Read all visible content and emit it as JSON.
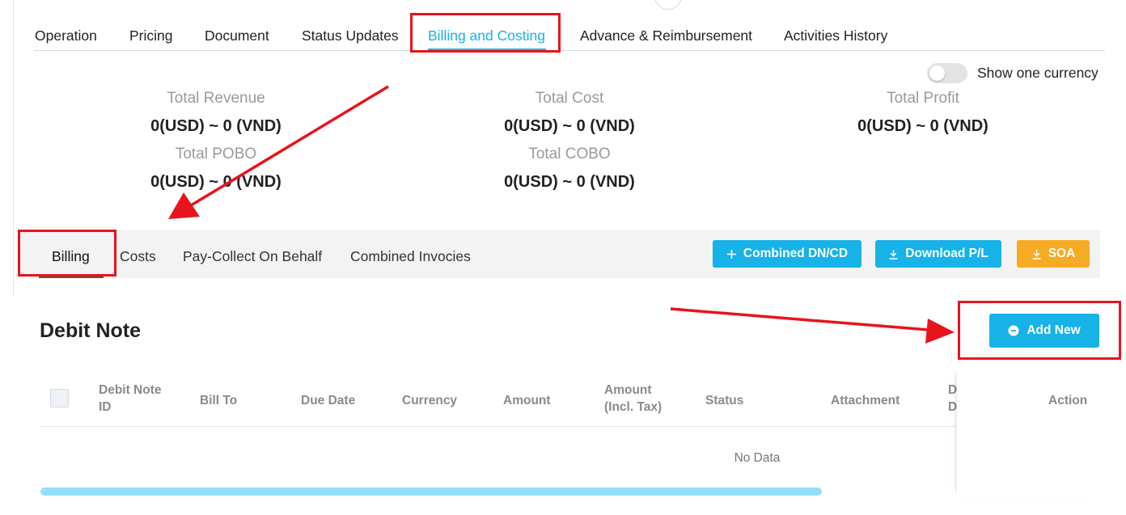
{
  "main_tabs": [
    {
      "label": "Operation"
    },
    {
      "label": "Pricing"
    },
    {
      "label": "Document"
    },
    {
      "label": "Status Updates"
    },
    {
      "label": "Billing and Costing",
      "active": true
    },
    {
      "label": "Advance & Reimbursement"
    },
    {
      "label": "Activities History"
    }
  ],
  "currency_toggle": {
    "label": "Show one currency",
    "on": false
  },
  "summary": {
    "total_revenue": {
      "label": "Total Revenue",
      "value": "0(USD) ~ 0 (VND)"
    },
    "total_cost": {
      "label": "Total Cost",
      "value": "0(USD) ~ 0 (VND)"
    },
    "total_profit": {
      "label": "Total Profit",
      "value": "0(USD) ~ 0 (VND)"
    },
    "total_pobo": {
      "label": "Total POBO",
      "value": "0(USD) ~ 0 (VND)"
    },
    "total_cobo": {
      "label": "Total COBO",
      "value": "0(USD) ~ 0 (VND)"
    }
  },
  "sub_tabs": [
    {
      "label": "Billing",
      "active": true
    },
    {
      "label": "Costs"
    },
    {
      "label": "Pay-Collect On Behalf"
    },
    {
      "label": "Combined Invocies"
    }
  ],
  "actions": {
    "combined_dn_cd": "Combined DN/CD",
    "download_pl": "Download P/L",
    "soa": "SOA"
  },
  "debit_note": {
    "title": "Debit Note",
    "add_new": "Add New",
    "columns": {
      "debit_note_id": [
        "Debit Note",
        "ID"
      ],
      "bill_to": "Bill To",
      "due_date": "Due Date",
      "currency": "Currency",
      "amount": "Amount",
      "amount_incl_tax": [
        "Amount",
        "(Incl. Tax)"
      ],
      "status": "Status",
      "attachment": "Attachment",
      "truncated": [
        "D",
        "D"
      ],
      "action": "Action"
    },
    "empty_text": "No Data"
  },
  "colors": {
    "accent": "#16b2e8",
    "orange": "#f6ab25",
    "annotation": "#e8141c",
    "scrollbar": "#93e0f6"
  }
}
